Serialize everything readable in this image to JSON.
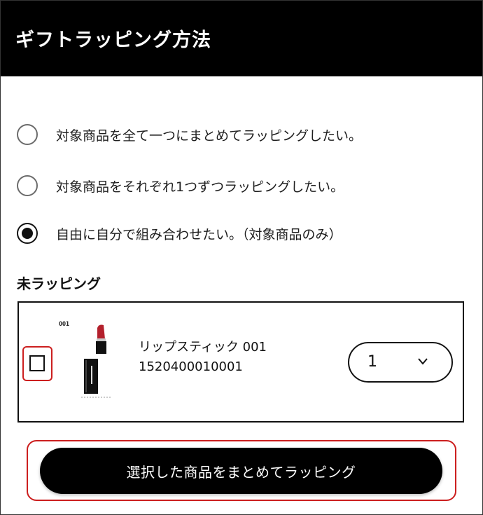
{
  "header": {
    "title": "ギフトラッピング方法"
  },
  "wrapping_options": [
    {
      "label": "対象商品を全て一つにまとめてラッピングしたい。",
      "selected": false
    },
    {
      "label": "対象商品をそれぞれ1つずつラッピングしたい。",
      "selected": false
    },
    {
      "label": "自由に自分で組み合わせたい。（対象商品のみ）",
      "selected": true
    }
  ],
  "unwrapped": {
    "heading": "未ラッピング",
    "item": {
      "shade_code": "001",
      "name": "リップスティック 001",
      "code": "1520400010001",
      "checked": false,
      "quantity": "1"
    }
  },
  "actions": {
    "wrap_selected_label": "選択した商品をまとめてラッピング"
  },
  "colors": {
    "header_bg": "#000000",
    "highlight": "#cc1f1f",
    "lipstick": "#b3202c"
  }
}
